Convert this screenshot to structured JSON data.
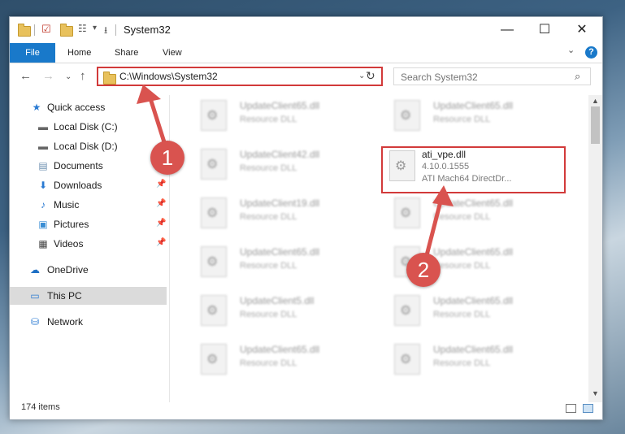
{
  "window": {
    "title": "System32",
    "controls": {
      "minimize": "—",
      "maximize": "☐",
      "close": "✕"
    }
  },
  "ribbon": {
    "tabs": [
      "File",
      "Home",
      "Share",
      "View"
    ],
    "help": "?"
  },
  "address": {
    "path": "C:\\Windows\\System32"
  },
  "search": {
    "placeholder": "Search System32"
  },
  "nav": {
    "items": [
      {
        "label": "Quick access",
        "icon": "star-icon",
        "pinned": false
      },
      {
        "label": "Local Disk (C:)",
        "icon": "drive-icon",
        "pinned": false
      },
      {
        "label": "Local Disk (D:)",
        "icon": "drive-icon",
        "pinned": false
      },
      {
        "label": "Documents",
        "icon": "documents-icon",
        "pinned": true
      },
      {
        "label": "Downloads",
        "icon": "download-icon",
        "pinned": true
      },
      {
        "label": "Music",
        "icon": "music-icon",
        "pinned": true
      },
      {
        "label": "Pictures",
        "icon": "pictures-icon",
        "pinned": true
      },
      {
        "label": "Videos",
        "icon": "videos-icon",
        "pinned": true
      },
      {
        "label": "OneDrive",
        "icon": "cloud-icon",
        "pinned": false
      },
      {
        "label": "This PC",
        "icon": "computer-icon",
        "pinned": false,
        "selected": true
      },
      {
        "label": "Network",
        "icon": "network-icon",
        "pinned": false
      }
    ]
  },
  "files": {
    "left": [
      {
        "name": "UpdateClient65.dll",
        "type": "Resource DLL"
      },
      {
        "name": "UpdateClient42.dll",
        "type": "Resource DLL"
      },
      {
        "name": "UpdateClient19.dll",
        "type": "Resource DLL"
      },
      {
        "name": "UpdateClient65.dll",
        "type": "Resource DLL"
      },
      {
        "name": "UpdateClient5.dll",
        "type": "Resource DLL"
      },
      {
        "name": "UpdateClient65.dll",
        "type": "Resource DLL"
      }
    ],
    "right": [
      {
        "name": "UpdateClient65.dll",
        "type": "Resource DLL"
      },
      {
        "name": "UpdateClient65.dll",
        "type": "Resource DLL"
      },
      {
        "name": "UpdateClient65.dll",
        "type": "Resource DLL"
      },
      {
        "name": "UpdateClient65.dll",
        "type": "Resource DLL"
      },
      {
        "name": "UpdateClient65.dll",
        "type": "Resource DLL"
      }
    ],
    "highlighted": {
      "name": "ati_vpe.dll",
      "version": "4.10.0.1555",
      "description": "ATI Mach64 DirectDr..."
    }
  },
  "status": {
    "item_count": "174 items"
  },
  "annotations": {
    "step1": "1",
    "step2": "2",
    "color": "#d9534f"
  }
}
